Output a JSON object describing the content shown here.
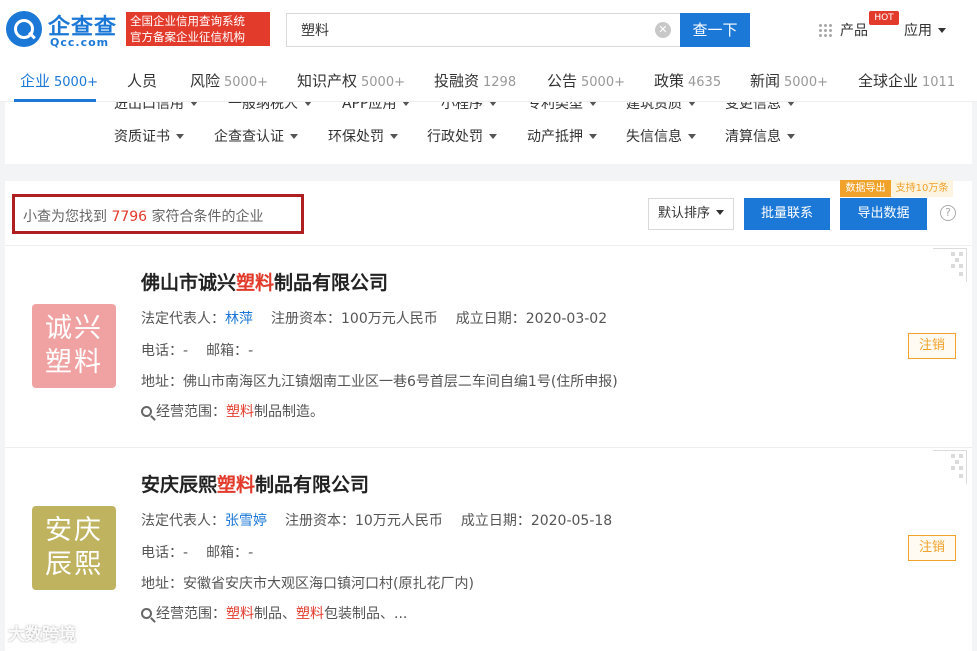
{
  "header": {
    "logo_cn": "企查查",
    "logo_en": "Qcc.com",
    "slogan_line1": "全国企业信用查询系统",
    "slogan_line2": "官方备案企业征信机构",
    "search_value": "塑料",
    "search_button": "查一下",
    "product_label": "产品",
    "hot_badge": "HOT",
    "app_label": "应用"
  },
  "tabs": [
    {
      "label": "企业",
      "count": "5000+"
    },
    {
      "label": "人员",
      "count": ""
    },
    {
      "label": "风险",
      "count": "5000+"
    },
    {
      "label": "知识产权",
      "count": "5000+"
    },
    {
      "label": "投融资",
      "count": "1298"
    },
    {
      "label": "公告",
      "count": "5000+"
    },
    {
      "label": "政策",
      "count": "4635"
    },
    {
      "label": "新闻",
      "count": "5000+"
    },
    {
      "label": "全球企业",
      "count": "1011"
    }
  ],
  "filters_row1": [
    "进出口信用",
    "一般纳税人",
    "APP应用",
    "小程序",
    "专利类型",
    "建筑资质",
    "变更信息"
  ],
  "filters_row2": [
    "资质证书",
    "企查查认证",
    "环保处罚",
    "行政处罚",
    "动产抵押",
    "失信信息",
    "清算信息"
  ],
  "results": {
    "prefix": "小查为您找到",
    "count": "7796",
    "suffix": "家符合条件的企业",
    "sort_label": "默认排序",
    "bulk_contact": "批量联系",
    "export_data": "导出数据",
    "export_tag": "数据导出",
    "export_note": "支持10万条",
    "help": "?"
  },
  "companies": [
    {
      "name_pre": "佛山市诚兴",
      "name_hl": "塑料",
      "name_post": "制品有限公司",
      "logo_line1": "诚兴",
      "logo_line2": "塑料",
      "logo_color": "#f0a2a2",
      "legal_label": "法定代表人：",
      "legal_rep": "林萍",
      "capital_label": "注册资本：",
      "capital": "100万元人民币",
      "date_label": "成立日期：",
      "date": "2020-03-02",
      "phone_label": "电话：",
      "phone": "-",
      "email_label": "邮箱：",
      "email": "-",
      "address_label": "地址：",
      "address": "佛山市南海区九江镇烟南工业区一巷6号首层二车间自编1号(住所申报)",
      "scope_label": "经营范围：",
      "scope_hl1": "塑料",
      "scope_text1": "制品制造。",
      "scope_hl2": "",
      "scope_text2": "",
      "status": "注销"
    },
    {
      "name_pre": "安庆辰熙",
      "name_hl": "塑料",
      "name_post": "制品有限公司",
      "logo_line1": "安庆",
      "logo_line2": "辰熙",
      "logo_color": "#bfb35f",
      "legal_label": "法定代表人：",
      "legal_rep": "张雪婷",
      "capital_label": "注册资本：",
      "capital": "10万元人民币",
      "date_label": "成立日期：",
      "date": "2020-05-18",
      "phone_label": "电话：",
      "phone": "-",
      "email_label": "邮箱：",
      "email": "-",
      "address_label": "地址：",
      "address": "安徽省安庆市大观区海口镇河口村(原扎花厂内)",
      "scope_label": "经营范围：",
      "scope_hl1": "塑料",
      "scope_text1": "制品、",
      "scope_hl2": "塑料",
      "scope_text2": "包装制品、...",
      "status": "注销"
    }
  ],
  "watermark": "大数跨境"
}
